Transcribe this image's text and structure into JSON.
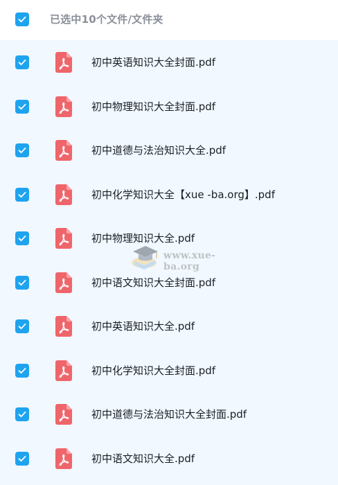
{
  "header": {
    "title": "已选中10个文件/文件夹"
  },
  "files": [
    {
      "name": "初中英语知识大全封面.pdf"
    },
    {
      "name": "初中物理知识大全封面.pdf"
    },
    {
      "name": "初中道德与法治知识大全.pdf"
    },
    {
      "name": "初中化学知识大全【xue -ba.org】.pdf"
    },
    {
      "name": "初中物理知识大全.pdf"
    },
    {
      "name": "初中语文知识大全封面.pdf"
    },
    {
      "name": "初中英语知识大全.pdf"
    },
    {
      "name": "初中化学知识大全封面.pdf"
    },
    {
      "name": "初中道德与法治知识大全封面.pdf"
    },
    {
      "name": "初中语文知识大全.pdf"
    }
  ],
  "watermark": {
    "text": "www.xue-ba.org"
  },
  "colors": {
    "checkbox": "#1fa3ef",
    "pdf_icon": "#f0656b",
    "list_bg": "#f1f8ff",
    "header_text": "#8a8f99"
  },
  "icons": {
    "checkbox": "check-icon",
    "file": "pdf-file-icon"
  }
}
